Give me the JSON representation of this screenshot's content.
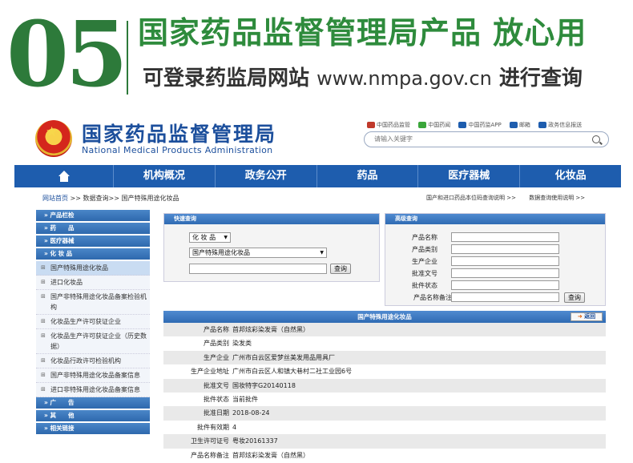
{
  "banner": {
    "number": "05",
    "headline": "国家药品监督管理局产品 放心用",
    "subline_prefix": "可登录药监局网站",
    "subline_url": "www.nmpa.gov.cn",
    "subline_suffix": "进行查询"
  },
  "header": {
    "title": "国家药品监督管理局",
    "subtitle": "National Medical Products Administration",
    "top_links": [
      "中国药品监管",
      "中国药闻",
      "中国药监APP",
      "邮箱",
      "政务信息报送"
    ],
    "search_placeholder": "请输入关键字"
  },
  "nav": [
    "机构概况",
    "政务公开",
    "药品",
    "医疗器械",
    "化妆品"
  ],
  "breadcrumb": {
    "home": "网站首页",
    "rest": ">>  数据查询>>  国产特殊用途化妆品"
  },
  "right_links": [
    "国产和进口药品本位码查询说明 >>",
    "数据查询使用说明 >>"
  ],
  "sidebar": {
    "categories_top": [
      "» 产品栏检",
      "» 药　　品",
      "» 医疗器械",
      "» 化 妆 品"
    ],
    "sub_items": [
      "国产特殊用途化妆品",
      "进口化妆品",
      "国产非特殊用途化妆品备案检验机构",
      "化妆品生产许可获证企业",
      "化妆品生产许可获证企业（历史数据）",
      "化妆品行政许可检验机构",
      "国产非特殊用途化妆品备案信息",
      "进口非特殊用途化妆品备案信息"
    ],
    "categories_bottom": [
      "» 广　　告",
      "» 其　　他",
      "» 相关链接"
    ]
  },
  "quick_search": {
    "title": "快速查询",
    "category_select": "化 妆 品",
    "type_select": "国产特殊用途化妆品",
    "query_button": "查询"
  },
  "advanced_search": {
    "title": "高级查询",
    "fields": [
      "产品名称",
      "产品类别",
      "生产企业",
      "批准文号",
      "批件状态",
      "产品名称备注"
    ],
    "query_button": "查询"
  },
  "detail": {
    "title": "国产特殊用途化妆品",
    "back_label": "返回",
    "rows": [
      {
        "label": "产品名称",
        "value": "首邦炫彩染发膏（自然黑）"
      },
      {
        "label": "产品类别",
        "value": "染发类"
      },
      {
        "label": "生产企业",
        "value": "广州市白云区爱梦丝美发用品用具厂"
      },
      {
        "label": "生产企业地址",
        "value": "广州市白云区人和镇大巷村二社工业园6号"
      },
      {
        "label": "批准文号",
        "value": "国妆特字G20140118"
      },
      {
        "label": "批件状态",
        "value": "当前批件"
      },
      {
        "label": "批准日期",
        "value": "2018-08-24"
      },
      {
        "label": "批件有效期",
        "value": "4"
      },
      {
        "label": "卫生许可证号",
        "value": "粤妆20161337"
      },
      {
        "label": "产品名称备注",
        "value": "首邦炫彩染发膏（自然黑）"
      }
    ]
  },
  "colors": {
    "banner_green": "#2e8b3c",
    "nav_blue": "#1e5dae",
    "title_blue": "#1c4f9c"
  }
}
